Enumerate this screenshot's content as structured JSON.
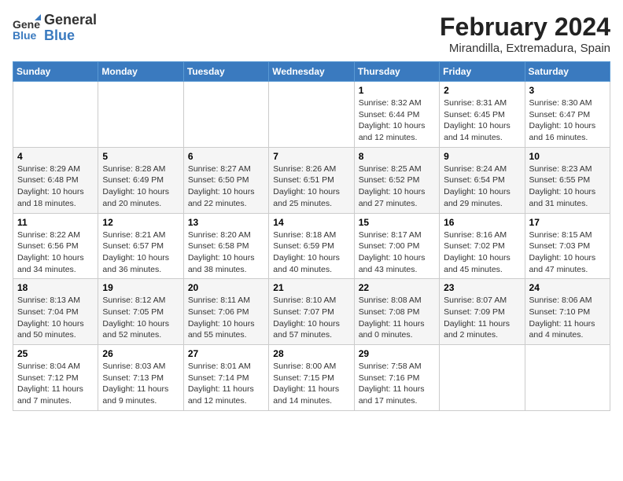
{
  "logo": {
    "line1": "General",
    "line2": "Blue"
  },
  "title": "February 2024",
  "location": "Mirandilla, Extremadura, Spain",
  "weekdays": [
    "Sunday",
    "Monday",
    "Tuesday",
    "Wednesday",
    "Thursday",
    "Friday",
    "Saturday"
  ],
  "weeks": [
    [
      {
        "day": "",
        "info": ""
      },
      {
        "day": "",
        "info": ""
      },
      {
        "day": "",
        "info": ""
      },
      {
        "day": "",
        "info": ""
      },
      {
        "day": "1",
        "info": "Sunrise: 8:32 AM\nSunset: 6:44 PM\nDaylight: 10 hours\nand 12 minutes."
      },
      {
        "day": "2",
        "info": "Sunrise: 8:31 AM\nSunset: 6:45 PM\nDaylight: 10 hours\nand 14 minutes."
      },
      {
        "day": "3",
        "info": "Sunrise: 8:30 AM\nSunset: 6:47 PM\nDaylight: 10 hours\nand 16 minutes."
      }
    ],
    [
      {
        "day": "4",
        "info": "Sunrise: 8:29 AM\nSunset: 6:48 PM\nDaylight: 10 hours\nand 18 minutes."
      },
      {
        "day": "5",
        "info": "Sunrise: 8:28 AM\nSunset: 6:49 PM\nDaylight: 10 hours\nand 20 minutes."
      },
      {
        "day": "6",
        "info": "Sunrise: 8:27 AM\nSunset: 6:50 PM\nDaylight: 10 hours\nand 22 minutes."
      },
      {
        "day": "7",
        "info": "Sunrise: 8:26 AM\nSunset: 6:51 PM\nDaylight: 10 hours\nand 25 minutes."
      },
      {
        "day": "8",
        "info": "Sunrise: 8:25 AM\nSunset: 6:52 PM\nDaylight: 10 hours\nand 27 minutes."
      },
      {
        "day": "9",
        "info": "Sunrise: 8:24 AM\nSunset: 6:54 PM\nDaylight: 10 hours\nand 29 minutes."
      },
      {
        "day": "10",
        "info": "Sunrise: 8:23 AM\nSunset: 6:55 PM\nDaylight: 10 hours\nand 31 minutes."
      }
    ],
    [
      {
        "day": "11",
        "info": "Sunrise: 8:22 AM\nSunset: 6:56 PM\nDaylight: 10 hours\nand 34 minutes."
      },
      {
        "day": "12",
        "info": "Sunrise: 8:21 AM\nSunset: 6:57 PM\nDaylight: 10 hours\nand 36 minutes."
      },
      {
        "day": "13",
        "info": "Sunrise: 8:20 AM\nSunset: 6:58 PM\nDaylight: 10 hours\nand 38 minutes."
      },
      {
        "day": "14",
        "info": "Sunrise: 8:18 AM\nSunset: 6:59 PM\nDaylight: 10 hours\nand 40 minutes."
      },
      {
        "day": "15",
        "info": "Sunrise: 8:17 AM\nSunset: 7:00 PM\nDaylight: 10 hours\nand 43 minutes."
      },
      {
        "day": "16",
        "info": "Sunrise: 8:16 AM\nSunset: 7:02 PM\nDaylight: 10 hours\nand 45 minutes."
      },
      {
        "day": "17",
        "info": "Sunrise: 8:15 AM\nSunset: 7:03 PM\nDaylight: 10 hours\nand 47 minutes."
      }
    ],
    [
      {
        "day": "18",
        "info": "Sunrise: 8:13 AM\nSunset: 7:04 PM\nDaylight: 10 hours\nand 50 minutes."
      },
      {
        "day": "19",
        "info": "Sunrise: 8:12 AM\nSunset: 7:05 PM\nDaylight: 10 hours\nand 52 minutes."
      },
      {
        "day": "20",
        "info": "Sunrise: 8:11 AM\nSunset: 7:06 PM\nDaylight: 10 hours\nand 55 minutes."
      },
      {
        "day": "21",
        "info": "Sunrise: 8:10 AM\nSunset: 7:07 PM\nDaylight: 10 hours\nand 57 minutes."
      },
      {
        "day": "22",
        "info": "Sunrise: 8:08 AM\nSunset: 7:08 PM\nDaylight: 11 hours\nand 0 minutes."
      },
      {
        "day": "23",
        "info": "Sunrise: 8:07 AM\nSunset: 7:09 PM\nDaylight: 11 hours\nand 2 minutes."
      },
      {
        "day": "24",
        "info": "Sunrise: 8:06 AM\nSunset: 7:10 PM\nDaylight: 11 hours\nand 4 minutes."
      }
    ],
    [
      {
        "day": "25",
        "info": "Sunrise: 8:04 AM\nSunset: 7:12 PM\nDaylight: 11 hours\nand 7 minutes."
      },
      {
        "day": "26",
        "info": "Sunrise: 8:03 AM\nSunset: 7:13 PM\nDaylight: 11 hours\nand 9 minutes."
      },
      {
        "day": "27",
        "info": "Sunrise: 8:01 AM\nSunset: 7:14 PM\nDaylight: 11 hours\nand 12 minutes."
      },
      {
        "day": "28",
        "info": "Sunrise: 8:00 AM\nSunset: 7:15 PM\nDaylight: 11 hours\nand 14 minutes."
      },
      {
        "day": "29",
        "info": "Sunrise: 7:58 AM\nSunset: 7:16 PM\nDaylight: 11 hours\nand 17 minutes."
      },
      {
        "day": "",
        "info": ""
      },
      {
        "day": "",
        "info": ""
      }
    ]
  ]
}
